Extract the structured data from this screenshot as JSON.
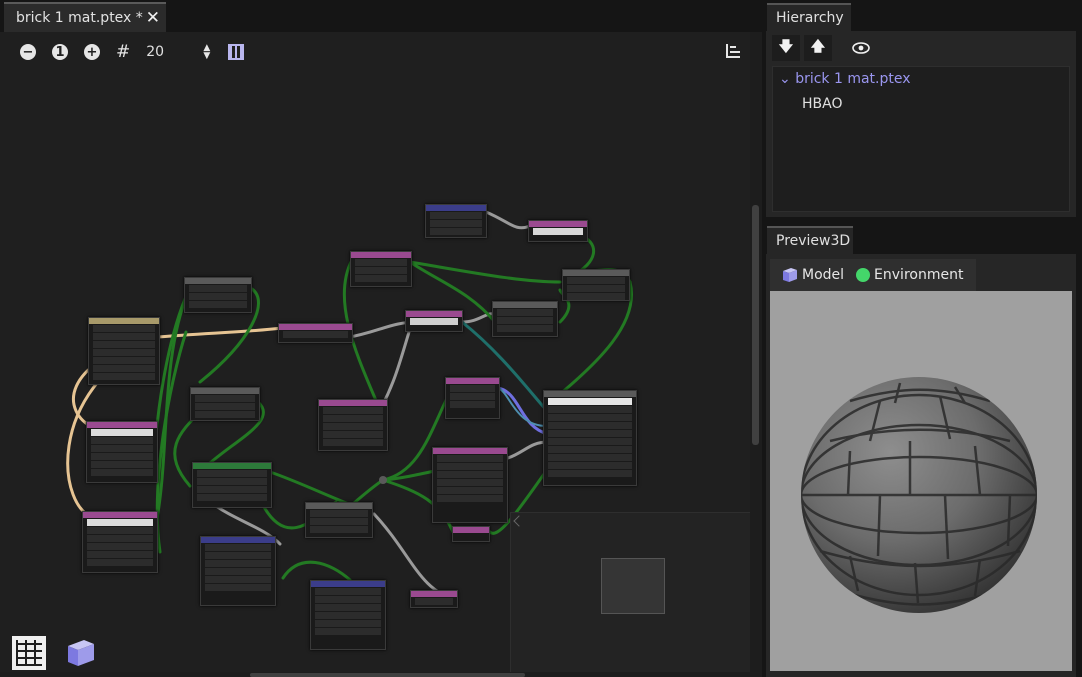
{
  "editor": {
    "tab_label": "brick 1 mat.ptex *",
    "close_glyph": "✕",
    "zoom_out_glyph": "−",
    "zoom_reset_glyph": "1",
    "zoom_in_glyph": "+",
    "grid_glyph": "#",
    "grid_size": "20",
    "icons": [
      "zoom-out-icon",
      "zoom-reset-icon",
      "zoom-in-icon",
      "grid-snap-icon",
      "atlas-icon",
      "align-icon",
      "brick-icon",
      "cube-icon"
    ]
  },
  "hierarchy": {
    "tab_label": "Hierarchy",
    "down_glyph": "🡇",
    "up_glyph": "🡅",
    "root_item": "brick 1 mat.ptex",
    "child_item": "HBAO"
  },
  "preview3d": {
    "tab_label": "Preview3D",
    "model_label": "Model",
    "environment_label": "Environment",
    "background_color": "#a0a0a0"
  },
  "colors": {
    "wire_green": "#237a23",
    "wire_gray": "#9a9a9a",
    "wire_cream": "#e6c493",
    "wire_blue": "#6f6fe0",
    "accent_purple": "#9a96ef",
    "node_pink": "#9a4a90",
    "node_navy": "#3b3d8a",
    "node_green": "#2d7a3a",
    "node_gray": "#5a5a5a",
    "node_tan": "#a89a6a"
  }
}
